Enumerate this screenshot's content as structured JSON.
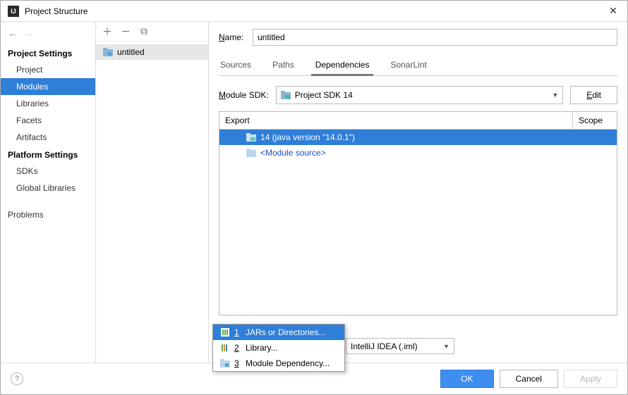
{
  "window": {
    "title": "Project Structure"
  },
  "sidebar": {
    "section1": "Project Settings",
    "items1": [
      "Project",
      "Modules",
      "Libraries",
      "Facets",
      "Artifacts"
    ],
    "section2": "Platform Settings",
    "items2": [
      "SDKs",
      "Global Libraries"
    ],
    "problems": "Problems"
  },
  "tree": {
    "module_name": "untitled"
  },
  "panel": {
    "name_label_pre": "N",
    "name_label_rest": "ame:",
    "name_value": "untitled",
    "tabs": [
      "Sources",
      "Paths",
      "Dependencies",
      "SonarLint"
    ],
    "active_tab": 2,
    "sdk_label_pre": "M",
    "sdk_label_rest": "odule SDK:",
    "sdk_value": "Project SDK 14",
    "edit_btn_pre": "E",
    "edit_btn_rest": "dit",
    "dep_head_export": "Export",
    "dep_head_scope": "Scope",
    "dep_rows": [
      {
        "label": "14 (java version \"14.0.1\")",
        "selected": true
      },
      {
        "label": "<Module source>",
        "source": true
      }
    ]
  },
  "popup": {
    "items": [
      {
        "n": "1",
        "label": "JARs or Directories...",
        "icon": "dir",
        "selected": true
      },
      {
        "n": "2",
        "label": "Library...",
        "icon": "lib"
      },
      {
        "n": "3",
        "label": "Module Dependency...",
        "icon": "mod"
      }
    ]
  },
  "export_combo": "IntelliJ IDEA (.iml)",
  "footer": {
    "ok": "OK",
    "cancel": "Cancel",
    "apply": "Apply"
  }
}
